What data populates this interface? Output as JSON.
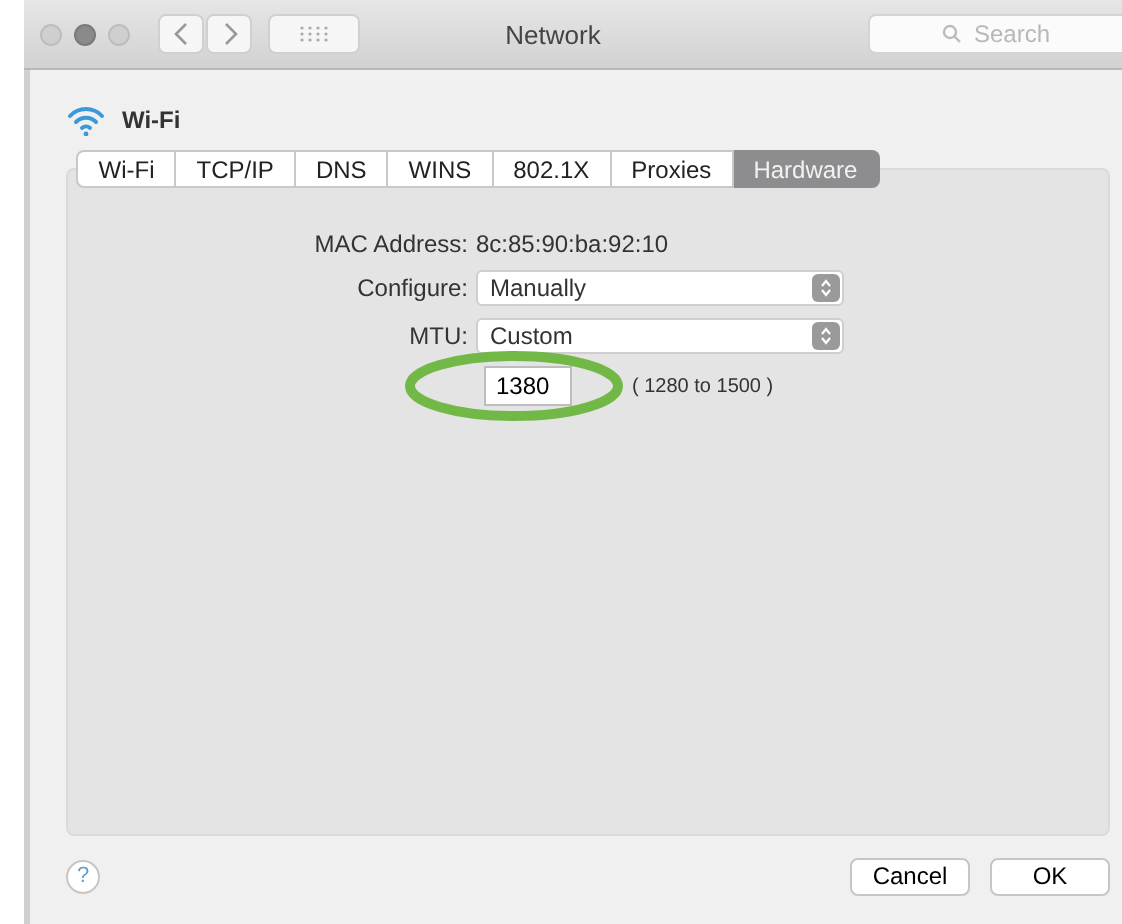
{
  "window": {
    "title": "Network",
    "search": {
      "placeholder": "Search"
    }
  },
  "header": {
    "label": "Wi-Fi"
  },
  "tabs": [
    {
      "label": "Wi-Fi",
      "selected": false
    },
    {
      "label": "TCP/IP",
      "selected": false
    },
    {
      "label": "DNS",
      "selected": false
    },
    {
      "label": "WINS",
      "selected": false
    },
    {
      "label": "802.1X",
      "selected": false
    },
    {
      "label": "Proxies",
      "selected": false
    },
    {
      "label": "Hardware",
      "selected": true
    }
  ],
  "form": {
    "mac": {
      "label": "MAC Address:",
      "value": "8c:85:90:ba:92:10"
    },
    "configure": {
      "label": "Configure:",
      "value": "Manually"
    },
    "mtu": {
      "label": "MTU:",
      "value": "Custom"
    },
    "mtu_value": {
      "value": "1380",
      "range": "( 1280 to 1500 )"
    }
  },
  "help": {
    "label": "?"
  },
  "buttons": [
    {
      "label": "Cancel"
    },
    {
      "label": "OK"
    }
  ]
}
